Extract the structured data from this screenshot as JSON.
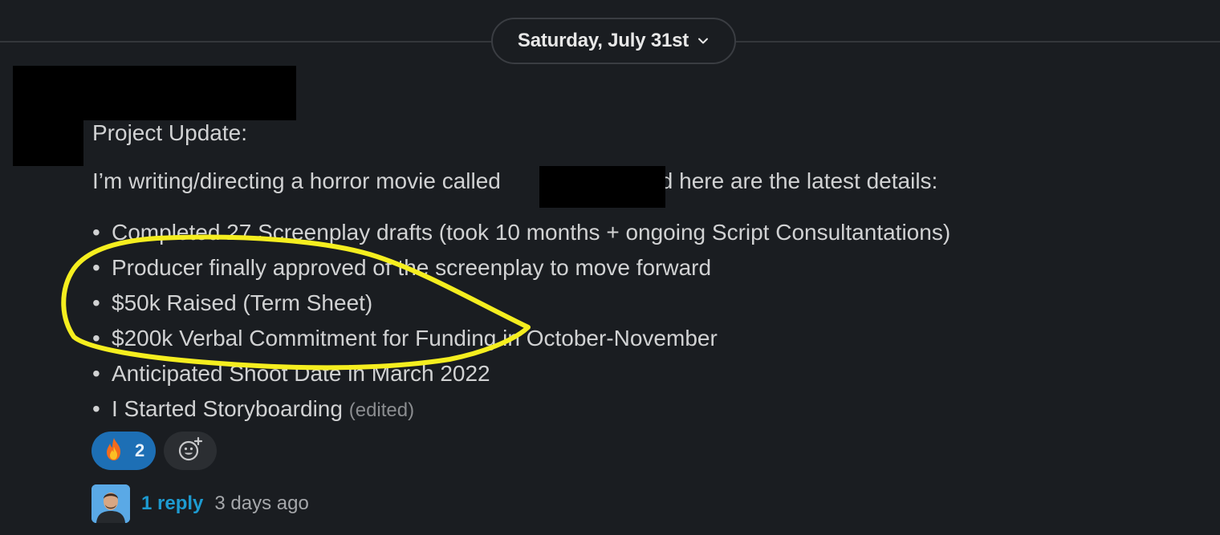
{
  "date_divider": {
    "label": "Saturday, July 31st",
    "chevron_icon": "chevron-down-icon"
  },
  "message": {
    "title": "Project Update:",
    "intro_before": "I’m writing/directing a horror movie called",
    "intro_after": "and here are the latest details:",
    "bullets": [
      "Completed 27 Screenplay drafts (took 10 months + ongoing Script Consultantations)",
      "Producer finally approved of the screenplay to move forward",
      "$50k Raised (Term Sheet)",
      "$200k Verbal Commitment for Funding in October-November",
      "Anticipated Shoot Date in March 2022",
      "I Started Storyboarding"
    ],
    "bullet_char": "•",
    "edited_label": "(edited)"
  },
  "reactions": {
    "items": [
      {
        "emoji": "🔥",
        "icon": "fire-emoji-icon",
        "count": "2"
      }
    ],
    "add_reaction_icon": "add-reaction-icon"
  },
  "thread": {
    "reply_label": "1 reply",
    "time_label": "3 days ago"
  },
  "colors": {
    "background": "#1a1d21",
    "text": "#d1d2d3",
    "link": "#1d9bd1",
    "reaction_selected": "#1d6fb5",
    "annotation_highlight": "#f5ee1f"
  }
}
